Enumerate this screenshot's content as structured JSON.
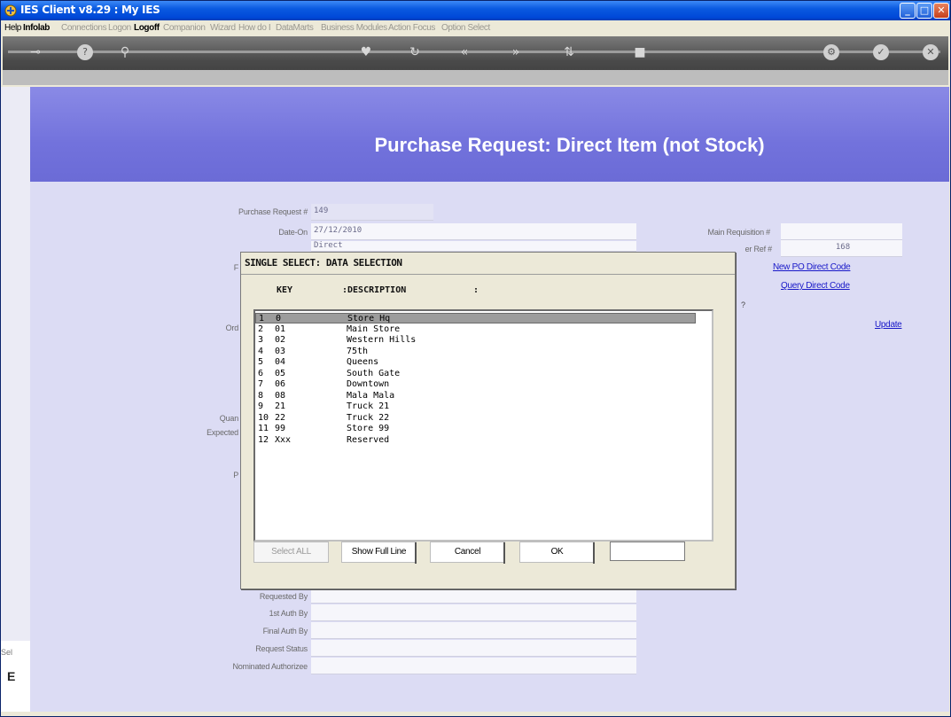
{
  "window": {
    "title": "IES Client v8.29 : My IES"
  },
  "menu": [
    {
      "label": "Help",
      "state": "on"
    },
    {
      "label": "Infolab",
      "state": "on-bold"
    },
    {
      "label": "Connections",
      "state": "off"
    },
    {
      "label": "Logon",
      "state": "off"
    },
    {
      "label": "Logoff",
      "state": "on-bold"
    },
    {
      "label": "Companion",
      "state": "off"
    },
    {
      "label": "Wizard",
      "state": "off"
    },
    {
      "label": "How do I",
      "state": "off"
    },
    {
      "label": "DataMarts",
      "state": "off"
    },
    {
      "label": "Business Modules",
      "state": "off"
    },
    {
      "label": "Action Focus",
      "state": "off"
    },
    {
      "label": "Option Select",
      "state": "off"
    }
  ],
  "toolbar_icons": [
    "key-icon",
    "help-icon",
    "search-icon",
    "heart-icon",
    "refresh-icon",
    "back-icon",
    "forward-icon",
    "nav-icon",
    "stop-icon",
    "settings-icon",
    "check-icon",
    "close-icon"
  ],
  "page": {
    "heading": "Purchase Request: Direct Item (not Stock)",
    "fields": {
      "purchase_request_label": "Purchase Request #",
      "purchase_request_value": "149",
      "date_on_label": "Date-On",
      "date_on_value": "27/12/2010",
      "type_value": "Direct",
      "main_requisition_label": "Main Requisition #",
      "main_requisition_value": "",
      "other_ref_label": "er Ref #",
      "other_ref_value": "168",
      "ord_label": "Ord",
      "quan_label": "Quan",
      "expected_label": "Expected",
      "p_label": "P",
      "f_label": "F",
      "question_mark": "?",
      "requested_by_label": "Requested By",
      "first_auth_label": "1st Auth By",
      "final_auth_label": "Final Auth By",
      "request_status_label": "Request Status",
      "nominated_authorizee_label": "Nominated Authorizee"
    },
    "links": {
      "new_po_direct_code": "New PO Direct Code",
      "query_direct_code": "Query Direct Code",
      "update": "Update"
    },
    "side_stub": {
      "top": "Sel",
      "bottom": "E"
    }
  },
  "dialog": {
    "title": "SINGLE SELECT: DATA SELECTION",
    "columns": {
      "key": "KEY",
      "description": ":DESCRIPTION",
      "sep": ":"
    },
    "rows": [
      {
        "n": "1",
        "key": "0",
        "desc": "Store Hq"
      },
      {
        "n": "2",
        "key": "01",
        "desc": "Main Store"
      },
      {
        "n": "3",
        "key": "02",
        "desc": "Western Hills"
      },
      {
        "n": "4",
        "key": "03",
        "desc": "75th"
      },
      {
        "n": "5",
        "key": "04",
        "desc": "Queens"
      },
      {
        "n": "6",
        "key": "05",
        "desc": "South Gate"
      },
      {
        "n": "7",
        "key": "06",
        "desc": "Downtown"
      },
      {
        "n": "8",
        "key": "08",
        "desc": "Mala Mala"
      },
      {
        "n": "9",
        "key": "21",
        "desc": "Truck 21"
      },
      {
        "n": "10",
        "key": "22",
        "desc": "Truck 22"
      },
      {
        "n": "11",
        "key": "99",
        "desc": "Store 99"
      },
      {
        "n": "12",
        "key": "Xxx",
        "desc": "Reserved"
      }
    ],
    "selected_row": 1,
    "buttons": {
      "select_all": "Select ALL",
      "show_full_line": "Show Full Line",
      "cancel": "Cancel",
      "ok": "OK"
    },
    "input_value": ""
  }
}
